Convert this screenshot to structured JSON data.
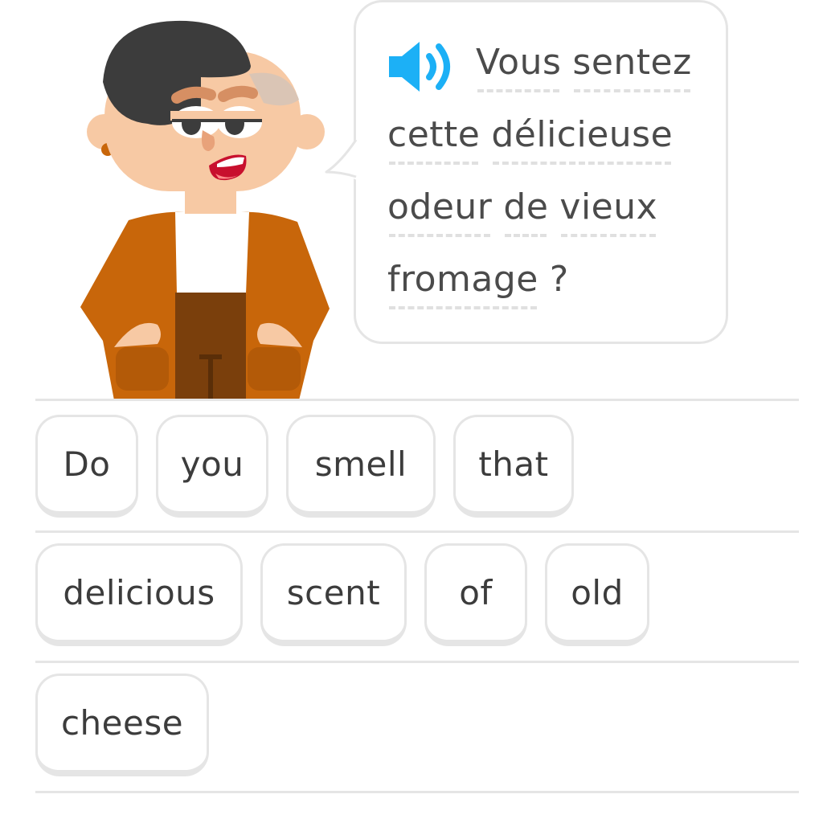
{
  "prompt": {
    "speaker_icon": "speaker-icon",
    "lines": [
      [
        "Vous",
        "sentez"
      ],
      [
        "cette",
        "délicieuse"
      ],
      [
        "odeur",
        "de",
        "vieux"
      ],
      [
        "fromage",
        "?"
      ]
    ]
  },
  "word_bank": {
    "tiles": [
      "Do",
      "you",
      "smell",
      "that",
      "delicious",
      "scent",
      "of",
      "old",
      "cheese"
    ]
  },
  "colors": {
    "accent": "#1cb0f6",
    "text": "#4b4b4b",
    "border": "#e5e5e5",
    "jacket": "#c8660a",
    "hair": "#3c3c3c"
  }
}
